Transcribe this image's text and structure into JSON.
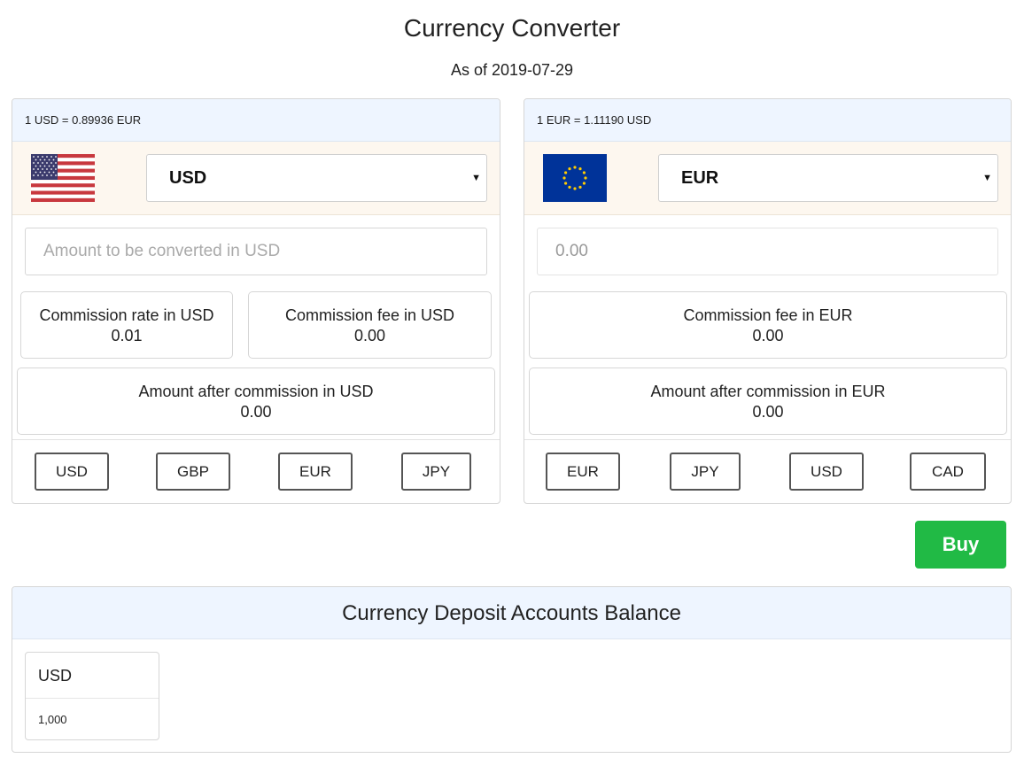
{
  "header": {
    "title": "Currency Converter",
    "as_of": "As of 2019-07-29"
  },
  "left_panel": {
    "rate_text": "1 USD = 0.89936 EUR",
    "flag_icon": "us-flag-icon",
    "selected_currency": "USD",
    "amount_placeholder": "Amount to be converted in USD",
    "commission_rate": {
      "label": "Commission rate in USD",
      "value": "0.01"
    },
    "commission_fee": {
      "label": "Commission fee in USD",
      "value": "0.00"
    },
    "amount_after": {
      "label": "Amount after commission in USD",
      "value": "0.00"
    },
    "quick_currencies": [
      "USD",
      "GBP",
      "EUR",
      "JPY"
    ]
  },
  "right_panel": {
    "rate_text": "1 EUR = 1.11190 USD",
    "flag_icon": "eu-flag-icon",
    "selected_currency": "EUR",
    "amount_value": "0.00",
    "commission_fee": {
      "label": "Commission fee in EUR",
      "value": "0.00"
    },
    "amount_after": {
      "label": "Amount after commission in EUR",
      "value": "0.00"
    },
    "quick_currencies": [
      "EUR",
      "JPY",
      "USD",
      "CAD"
    ]
  },
  "buy_button": {
    "label": "Buy",
    "color": "#21ba45"
  },
  "deposit": {
    "title": "Currency Deposit Accounts Balance",
    "accounts": [
      {
        "currency": "USD",
        "balance": "1,000"
      }
    ]
  },
  "colors": {
    "rate_bar_bg": "#eef5ff",
    "select_bar_bg": "#fdf7ef"
  }
}
